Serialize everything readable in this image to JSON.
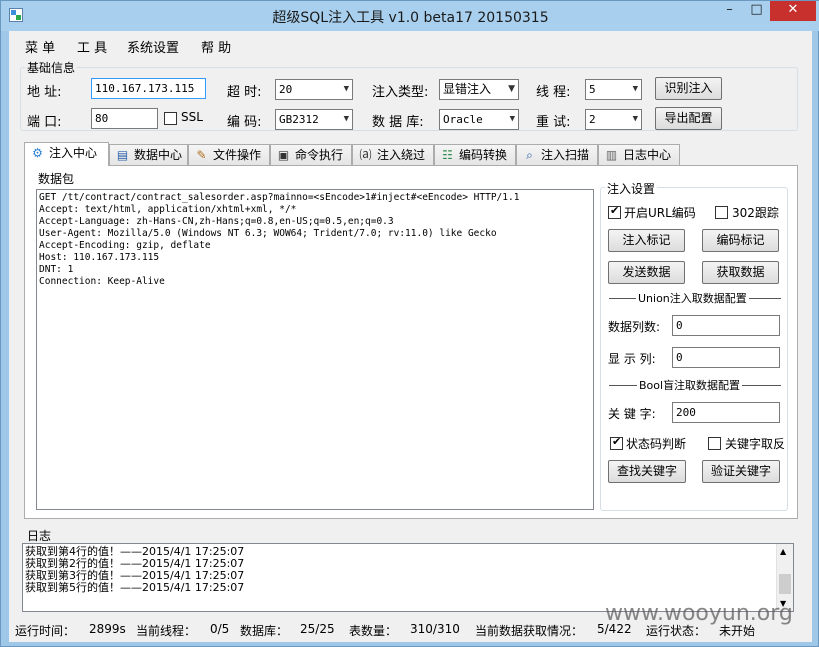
{
  "window": {
    "title": "超级SQL注入工具 v1.0 beta17 20150315",
    "controls": {
      "minimize": "–",
      "maximize": "□",
      "close": "✕"
    }
  },
  "menubar": [
    "菜 单",
    "工 具",
    "系统设置",
    "帮 助"
  ],
  "basic_info": {
    "group_label": "基础信息",
    "address_label": "地 址:",
    "address_value": "110.167.173.115",
    "port_label": "端 口:",
    "port_value": "80",
    "ssl_label": "SSL",
    "timeout_label": "超 时:",
    "timeout_value": "20",
    "encoding_label": "编 码:",
    "encoding_value": "GB2312",
    "inject_type_label": "注入类型:",
    "inject_type_value": "显错注入",
    "database_label": "数 据 库:",
    "database_value": "Oracle",
    "threads_label": "线 程:",
    "threads_value": "5",
    "retry_label": "重 试:",
    "retry_value": "2",
    "identify_button": "识别注入",
    "export_button": "导出配置"
  },
  "tabs": [
    {
      "label": "注入中心",
      "icon": "⚙",
      "icon_name": "gear-icon"
    },
    {
      "label": "数据中心",
      "icon": "▤",
      "icon_name": "database-icon"
    },
    {
      "label": "文件操作",
      "icon": "✎",
      "icon_name": "file-edit-icon"
    },
    {
      "label": "命令执行",
      "icon": "▣",
      "icon_name": "terminal-icon"
    },
    {
      "label": "注入绕过",
      "icon": "⒜",
      "icon_name": "bypass-icon"
    },
    {
      "label": "编码转换",
      "icon": "☷",
      "icon_name": "encode-icon"
    },
    {
      "label": "注入扫描",
      "icon": "⌕",
      "icon_name": "scan-icon"
    },
    {
      "label": "日志中心",
      "icon": "▥",
      "icon_name": "log-book-icon"
    }
  ],
  "packet": {
    "group_label": "数据包",
    "content": "GET /tt/contract/contract_salesorder.asp?mainno=<sEncode>1#inject#<eEncode> HTTP/1.1\nAccept: text/html, application/xhtml+xml, */*\nAccept-Language: zh-Hans-CN,zh-Hans;q=0.8,en-US;q=0.5,en;q=0.3\nUser-Agent: Mozilla/5.0 (Windows NT 6.3; WOW64; Trident/7.0; rv:11.0) like Gecko\nAccept-Encoding: gzip, deflate\nHost: 110.167.173.115\nDNT: 1\nConnection: Keep-Alive"
  },
  "inject_settings": {
    "group_label": "注入设置",
    "url_encode_label": "开启URL编码",
    "url_encode_checked": true,
    "follow_302_label": "302跟踪",
    "follow_302_checked": false,
    "mark_inject_button": "注入标记",
    "mark_encode_button": "编码标记",
    "send_button": "发送数据",
    "fetch_button": "获取数据",
    "union_header": "Union注入取数据配置",
    "columns_label": "数据列数:",
    "columns_value": "0",
    "display_col_label": "显 示 列:",
    "display_col_value": "0",
    "bool_header": "Bool盲注取数据配置",
    "keyword_label": "关 键 字:",
    "keyword_value": "200",
    "status_code_label": "状态码判断",
    "status_code_checked": true,
    "keyword_invert_label": "关键字取反",
    "keyword_invert_checked": false,
    "find_keyword_button": "查找关键字",
    "verify_keyword_button": "验证关键字"
  },
  "log": {
    "group_label": "日志",
    "lines": [
      "获取到第4行的值！——2015/4/1 17:25:07",
      "获取到第2行的值！——2015/4/1 17:25:07",
      "获取到第3行的值！——2015/4/1 17:25:07",
      "获取到第5行的值！——2015/4/1 17:25:07"
    ]
  },
  "status": {
    "runtime_label": "运行时间：",
    "runtime_value": "2899s",
    "threads_label": "当前线程：",
    "threads_value": "0/5",
    "db_label": "数据库：",
    "db_value": "25/25",
    "table_label": "表数量：",
    "table_value": "310/310",
    "progress_label": "当前数据获取情况：",
    "progress_value": "5/422",
    "run_state_label": "运行状态：",
    "run_state_value": "未开始"
  },
  "watermark": "www.wooyun.org"
}
